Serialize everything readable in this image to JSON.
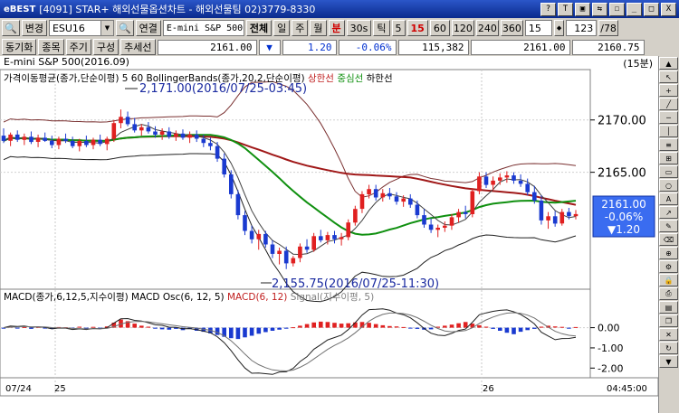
{
  "window": {
    "logo": "eBEST",
    "title": "[4091] STAR+ 해외선물옵션차트 - 해외선물팀 02)3779-8330",
    "buttons": [
      "?",
      "T",
      "▣",
      "⇆",
      "☐",
      "_",
      "□",
      "X"
    ]
  },
  "toolbar1": {
    "change_label": "변경",
    "symbol": "ESU16",
    "symbol_name": "E-mini S&P 500",
    "connect_label": "연결",
    "view_label": "전체",
    "periods": [
      "일",
      "주",
      "월",
      "분",
      "30s",
      "틱"
    ],
    "minutes": [
      "5",
      "15",
      "60",
      "120",
      "240",
      "360"
    ],
    "active_minute": "15",
    "interval_value": "15",
    "count_value": "123",
    "count_total": "78"
  },
  "toolbar2": {
    "sync_label": "동기화",
    "items_label": "종목",
    "period_label": "주기",
    "layout_label": "구성",
    "trend_label": "추세선",
    "price": "2161.00",
    "direction": "▼",
    "change": "1.20",
    "change_pct": "-0.06%",
    "volume": "115,382",
    "price2": "2161.00",
    "price3": "2160.75"
  },
  "chart": {
    "header_title": "E-mini S&P 500(2016.09)",
    "timeframe": "(15분)",
    "legend_prefix": "가격이동평균(종가,단순이평) 5 60",
    "legend_bb": "BollingerBands(종가,20,2,단순이평)",
    "legend_upper": "상한선",
    "legend_mid": "중심선",
    "legend_lower": "하한선",
    "high_annotation": "2,171.00(2016/07/25-03:45)",
    "low_annotation": "2,155.75(2016/07/25-11:30)",
    "price_badge": {
      "price": "2161.00",
      "pct": "-0.06%",
      "change": "▼1.20"
    },
    "macd_legend_prefix": "MACD(종가,6,12,5,지수이평)",
    "macd_legend_osc": "MACD Osc(6, 12, 5)",
    "macd_legend_macd": "MACD(6, 12)",
    "macd_legend_signal": "Signal(지수이평, 5)",
    "date_labels": [
      "07/24",
      "25",
      "26"
    ],
    "time_label": "04:45:00"
  },
  "chart_data": {
    "type": "candlestick",
    "price_axis": {
      "ticks": [
        2170.0,
        2165.0
      ],
      "tick_labels": [
        "2170.00",
        "2165.00"
      ],
      "range": [
        2154.0,
        2173.0
      ]
    },
    "macd_axis": {
      "ticks": [
        0.0,
        -1.0,
        -2.0
      ],
      "tick_labels": [
        "0.00",
        "-1.00",
        "-2.00"
      ],
      "range": [
        -2.3,
        1.1
      ]
    },
    "candles": [
      [
        2168.5,
        2169.2,
        2167.8,
        2168.0
      ],
      [
        2168.0,
        2168.8,
        2167.5,
        2168.6
      ],
      [
        2168.6,
        2169.0,
        2167.9,
        2168.1
      ],
      [
        2168.1,
        2168.7,
        2167.6,
        2168.4
      ],
      [
        2168.4,
        2168.9,
        2167.7,
        2167.9
      ],
      [
        2167.9,
        2168.6,
        2167.4,
        2168.3
      ],
      [
        2168.3,
        2168.8,
        2167.9,
        2168.0
      ],
      [
        2168.0,
        2168.5,
        2167.3,
        2167.6
      ],
      [
        2167.6,
        2168.4,
        2167.2,
        2168.2
      ],
      [
        2168.2,
        2168.7,
        2167.8,
        2168.0
      ],
      [
        2168.0,
        2168.4,
        2167.3,
        2167.5
      ],
      [
        2167.5,
        2168.2,
        2167.0,
        2168.0
      ],
      [
        2168.0,
        2168.5,
        2167.4,
        2167.6
      ],
      [
        2167.6,
        2168.3,
        2167.2,
        2168.1
      ],
      [
        2168.1,
        2168.6,
        2167.5,
        2167.7
      ],
      [
        2167.7,
        2168.4,
        2167.1,
        2168.2
      ],
      [
        2168.2,
        2170.0,
        2167.9,
        2169.7
      ],
      [
        2169.7,
        2171.0,
        2169.2,
        2170.3
      ],
      [
        2170.3,
        2170.8,
        2169.4,
        2169.6
      ],
      [
        2169.6,
        2170.2,
        2168.8,
        2169.0
      ],
      [
        2169.0,
        2169.6,
        2168.5,
        2169.3
      ],
      [
        2169.3,
        2169.8,
        2168.7,
        2168.9
      ],
      [
        2168.9,
        2169.4,
        2168.3,
        2168.6
      ],
      [
        2168.6,
        2169.2,
        2168.1,
        2168.9
      ],
      [
        2168.9,
        2169.3,
        2168.2,
        2168.4
      ],
      [
        2168.4,
        2169.0,
        2168.0,
        2168.7
      ],
      [
        2168.7,
        2169.1,
        2168.1,
        2168.3
      ],
      [
        2168.3,
        2168.9,
        2167.8,
        2168.6
      ],
      [
        2168.6,
        2169.0,
        2167.9,
        2168.2
      ],
      [
        2168.2,
        2168.6,
        2167.4,
        2167.8
      ],
      [
        2167.8,
        2168.3,
        2167.1,
        2167.5
      ],
      [
        2167.5,
        2167.9,
        2166.0,
        2166.3
      ],
      [
        2166.3,
        2166.8,
        2164.5,
        2164.8
      ],
      [
        2164.8,
        2165.2,
        2162.5,
        2162.9
      ],
      [
        2162.9,
        2163.3,
        2160.5,
        2160.9
      ],
      [
        2160.9,
        2161.3,
        2159.0,
        2159.4
      ],
      [
        2159.4,
        2159.9,
        2158.2,
        2158.6
      ],
      [
        2158.6,
        2159.5,
        2157.6,
        2159.1
      ],
      [
        2159.1,
        2159.4,
        2157.8,
        2158.1
      ],
      [
        2158.1,
        2158.5,
        2156.8,
        2157.2
      ],
      [
        2157.2,
        2157.8,
        2156.2,
        2157.5
      ],
      [
        2157.5,
        2157.9,
        2155.75,
        2156.3
      ],
      [
        2156.3,
        2157.0,
        2156.0,
        2156.8
      ],
      [
        2156.8,
        2158.2,
        2156.4,
        2157.9
      ],
      [
        2157.9,
        2158.6,
        2157.3,
        2157.6
      ],
      [
        2157.6,
        2159.2,
        2157.4,
        2158.9
      ],
      [
        2158.9,
        2159.5,
        2158.3,
        2158.5
      ],
      [
        2158.5,
        2159.3,
        2158.1,
        2159.0
      ],
      [
        2159.0,
        2159.4,
        2158.2,
        2158.6
      ],
      [
        2158.6,
        2159.2,
        2158.0,
        2158.8
      ],
      [
        2158.8,
        2160.5,
        2158.5,
        2160.2
      ],
      [
        2160.2,
        2161.8,
        2159.9,
        2161.5
      ],
      [
        2161.5,
        2163.2,
        2161.1,
        2162.9
      ],
      [
        2162.9,
        2163.8,
        2162.5,
        2163.4
      ],
      [
        2163.4,
        2163.8,
        2162.3,
        2162.6
      ],
      [
        2162.6,
        2163.4,
        2162.2,
        2163.0
      ],
      [
        2163.0,
        2163.5,
        2162.4,
        2162.7
      ],
      [
        2162.7,
        2163.1,
        2161.9,
        2162.2
      ],
      [
        2162.2,
        2162.8,
        2161.7,
        2162.5
      ],
      [
        2162.5,
        2162.9,
        2161.6,
        2161.9
      ],
      [
        2161.9,
        2162.3,
        2160.6,
        2160.9
      ],
      [
        2160.9,
        2161.5,
        2159.7,
        2160.0
      ],
      [
        2160.0,
        2160.6,
        2159.2,
        2159.5
      ],
      [
        2159.5,
        2160.0,
        2158.8,
        2159.7
      ],
      [
        2159.7,
        2160.3,
        2159.3,
        2159.9
      ],
      [
        2159.9,
        2161.0,
        2159.5,
        2160.7
      ],
      [
        2160.7,
        2161.5,
        2160.2,
        2161.2
      ],
      [
        2161.2,
        2161.8,
        2160.6,
        2161.0
      ],
      [
        2161.0,
        2163.5,
        2160.7,
        2163.2
      ],
      [
        2163.2,
        2165.0,
        2162.9,
        2164.6
      ],
      [
        2164.6,
        2165.0,
        2163.5,
        2163.8
      ],
      [
        2163.8,
        2164.6,
        2163.3,
        2164.2
      ],
      [
        2164.2,
        2164.9,
        2163.8,
        2164.5
      ],
      [
        2164.5,
        2165.1,
        2164.0,
        2164.7
      ],
      [
        2164.7,
        2165.0,
        2163.9,
        2164.2
      ],
      [
        2164.2,
        2164.8,
        2163.6,
        2163.9
      ],
      [
        2163.9,
        2164.4,
        2162.8,
        2163.1
      ],
      [
        2163.1,
        2163.7,
        2162.0,
        2162.3
      ],
      [
        2162.3,
        2162.8,
        2160.0,
        2160.4
      ],
      [
        2160.4,
        2161.2,
        2159.6,
        2160.8
      ],
      [
        2160.8,
        2161.3,
        2159.8,
        2160.1
      ],
      [
        2160.1,
        2161.5,
        2159.9,
        2161.2
      ],
      [
        2161.2,
        2161.6,
        2160.5,
        2160.8
      ],
      [
        2160.8,
        2161.4,
        2160.5,
        2161.0
      ]
    ],
    "macd_histogram": [
      -0.05,
      0.05,
      -0.04,
      0.03,
      -0.06,
      0.04,
      -0.03,
      -0.05,
      0.03,
      0.02,
      -0.04,
      0.05,
      -0.03,
      0.04,
      -0.02,
      0.06,
      0.25,
      0.4,
      0.32,
      0.2,
      0.1,
      0.05,
      -0.05,
      -0.08,
      -0.1,
      -0.06,
      -0.12,
      -0.05,
      -0.15,
      -0.2,
      -0.28,
      -0.36,
      -0.45,
      -0.52,
      -0.56,
      -0.48,
      -0.4,
      -0.3,
      -0.22,
      -0.15,
      -0.1,
      -0.05,
      0.02,
      0.1,
      0.18,
      0.26,
      0.3,
      0.28,
      0.24,
      0.2,
      0.22,
      0.26,
      0.28,
      0.24,
      0.18,
      0.12,
      0.08,
      0.06,
      0.03,
      -0.02,
      -0.06,
      -0.1,
      -0.08,
      0.05,
      0.1,
      0.15,
      0.22,
      0.28,
      0.2,
      0.12,
      0.05,
      -0.06,
      -0.15,
      -0.25,
      -0.32,
      -0.2,
      -0.12,
      -0.06,
      0.05,
      0.1,
      0.06,
      0.04,
      -0.05,
      0.03
    ]
  }
}
